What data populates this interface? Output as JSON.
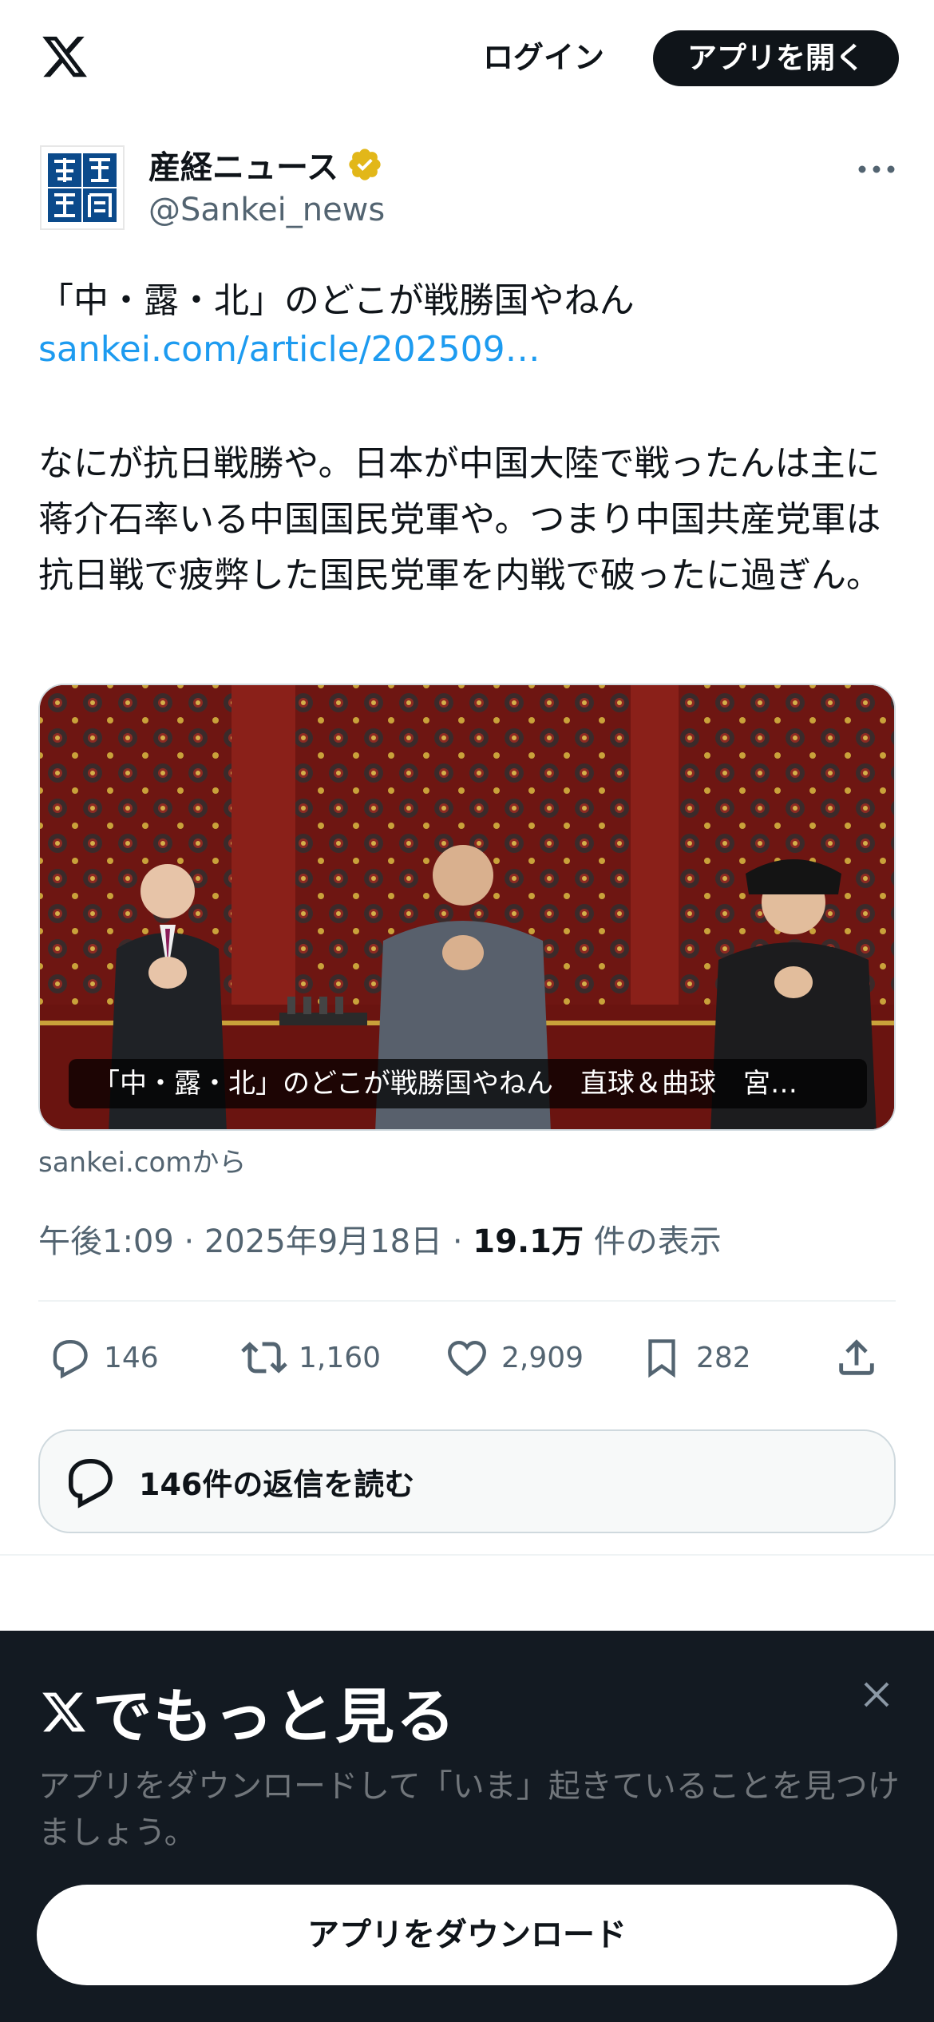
{
  "header": {
    "login_label": "ログイン",
    "open_app_label": "アプリを開く"
  },
  "author": {
    "name": "産経ニュース",
    "handle": "@Sankei_news",
    "avatar_text": "産経新聞"
  },
  "tweet": {
    "title": "「中・露・北」のどこが戦勝国やねん",
    "link": "sankei.com/article/202509…",
    "body": "なにが抗日戦勝や。日本が中国大陸で戦ったんは主に蒋介石率いる中国国民党軍や。つまり中国共産党軍は抗日戦で疲弊した国民党軍を内戦で破ったに過ぎん。",
    "media_caption": "「中・露・北」のどこが戦勝国やねん　直球＆曲球　宮…",
    "source": "sankei.comから",
    "time": "午後1:09",
    "date": "2025年9月18日",
    "views": "19.1万",
    "views_suffix": "件の表示",
    "separator": "·"
  },
  "actions": {
    "replies": "146",
    "retweets": "1,160",
    "likes": "2,909",
    "bookmarks": "282"
  },
  "read_replies_label": "146件の返信を読む",
  "sheet": {
    "title": "でもっと見る",
    "description": "アプリをダウンロードして「いま」起きていることを見つけましょう。",
    "download_label": "アプリをダウンロード"
  },
  "colors": {
    "link": "#1d9bf0",
    "secondary_text": "#536471",
    "sheet_bg": "#131a22",
    "verified_gold": "#e2b719"
  }
}
